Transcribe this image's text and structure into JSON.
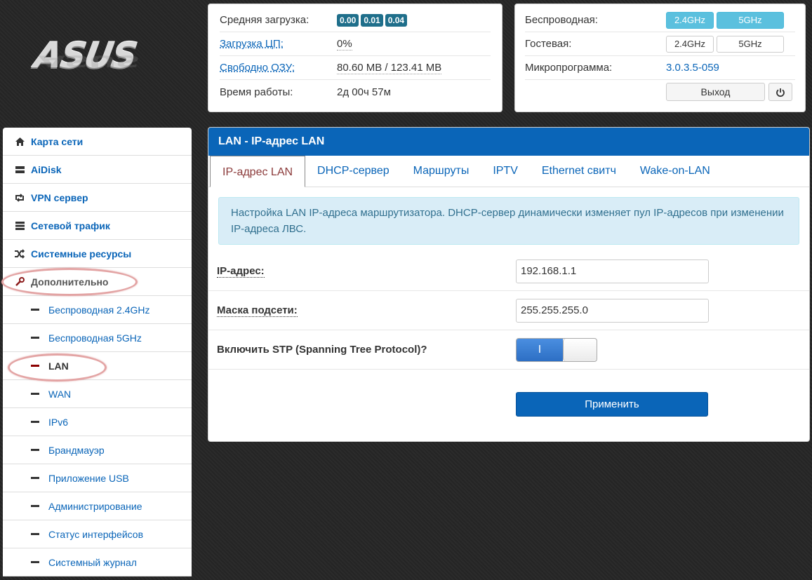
{
  "logo": {
    "text": "ASUS"
  },
  "stats": {
    "load_label": "Средняя загрузка:",
    "load_values": [
      "0.00",
      "0.01",
      "0.04"
    ],
    "cpu_label": "Загрузка ЦП:",
    "cpu_value": "0%",
    "ram_label": "Свободно ОЗУ:",
    "ram_value": "80.60 MB / 123.41 MB",
    "uptime_label": "Время работы:",
    "uptime_value": "2д 00ч 57м"
  },
  "radio": {
    "wireless_label": "Беспроводная:",
    "guest_label": "Гостевая:",
    "band_24": "2.4GHz",
    "band_5": "5GHz",
    "firmware_label": "Микропрограмма:",
    "firmware_value": "3.0.3.5-059",
    "exit_label": "Выход"
  },
  "sidebar": {
    "items": [
      {
        "label": "Карта сети",
        "icon": "home-icon"
      },
      {
        "label": "AiDisk",
        "icon": "disk-icon"
      },
      {
        "label": "VPN сервер",
        "icon": "retweet-icon"
      },
      {
        "label": "Сетевой трафик",
        "icon": "list-icon"
      },
      {
        "label": "Системные ресурсы",
        "icon": "shuffle-icon"
      },
      {
        "label": "Дополнительно",
        "icon": "wrench-icon"
      }
    ],
    "sub_items": [
      "Беспроводная 2.4GHz",
      "Беспроводная 5GHz",
      "LAN",
      "WAN",
      "IPv6",
      "Брандмауэр",
      "Приложение USB",
      "Администрирование",
      "Статус интерфейсов",
      "Системный журнал"
    ]
  },
  "main": {
    "title": "LAN - IP-адрес LAN",
    "tabs": [
      "IP-адрес LAN",
      "DHCP-сервер",
      "Маршруты",
      "IPTV",
      "Ethernet свитч",
      "Wake-on-LAN"
    ],
    "info": "Настройка LAN IP-адреса маршрутизатора. DHCP-сервер динамически изменяет пул IP-адресов при изменении IP-адреса ЛВС.",
    "ip_label": "IP-адрес:",
    "ip_value": "192.168.1.1",
    "mask_label": "Маска подсети:",
    "mask_value": "255.255.255.0",
    "stp_label": "Включить STP (Spanning Tree Protocol)?",
    "stp_on_text": "I",
    "apply_label": "Применить"
  }
}
